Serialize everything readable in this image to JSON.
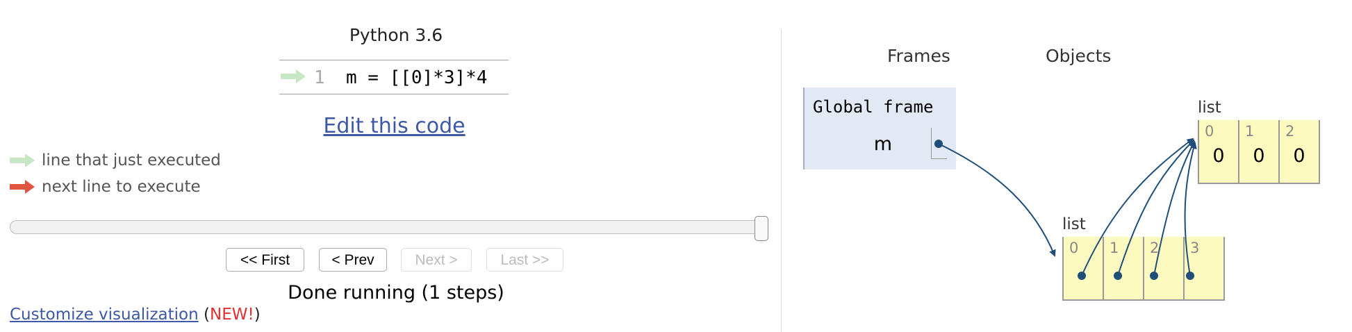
{
  "code_panel": {
    "language": "Python 3.6",
    "lines": [
      {
        "number": "1",
        "text": "m = [[0]*3]*4",
        "marker": "just-executed"
      }
    ],
    "edit_link": "Edit this code",
    "legend": {
      "just_executed": "line that just executed",
      "next_line": "next line to execute"
    },
    "colors": {
      "just_executed_arrow": "#c7e6c4",
      "next_line_arrow": "#e05441",
      "link": "#3d58a7",
      "new_badge": "#e03030"
    }
  },
  "controls": {
    "slider_position": 1.0,
    "first_label": "<< First",
    "prev_label": "< Prev",
    "next_label": "Next >",
    "last_label": "Last >>",
    "next_disabled": true,
    "last_disabled": true,
    "status": "Done running (1 steps)"
  },
  "footer": {
    "customize_link": "Customize visualization",
    "open_paren": "(",
    "new_badge": "NEW!",
    "close_paren": ")"
  },
  "visualization": {
    "frames_header": "Frames",
    "objects_header": "Objects",
    "global_frame": {
      "title": "Global frame",
      "variables": [
        {
          "name": "m"
        }
      ]
    },
    "inner_list": {
      "label": "list",
      "indices": [
        "0",
        "1",
        "2"
      ],
      "values": [
        "0",
        "0",
        "0"
      ]
    },
    "outer_list": {
      "label": "list",
      "indices": [
        "0",
        "1",
        "2",
        "3"
      ]
    },
    "colors": {
      "frame_bg": "#e2e9f5",
      "object_bg": "#fdfabf",
      "pointer": "#1f4e79"
    }
  }
}
